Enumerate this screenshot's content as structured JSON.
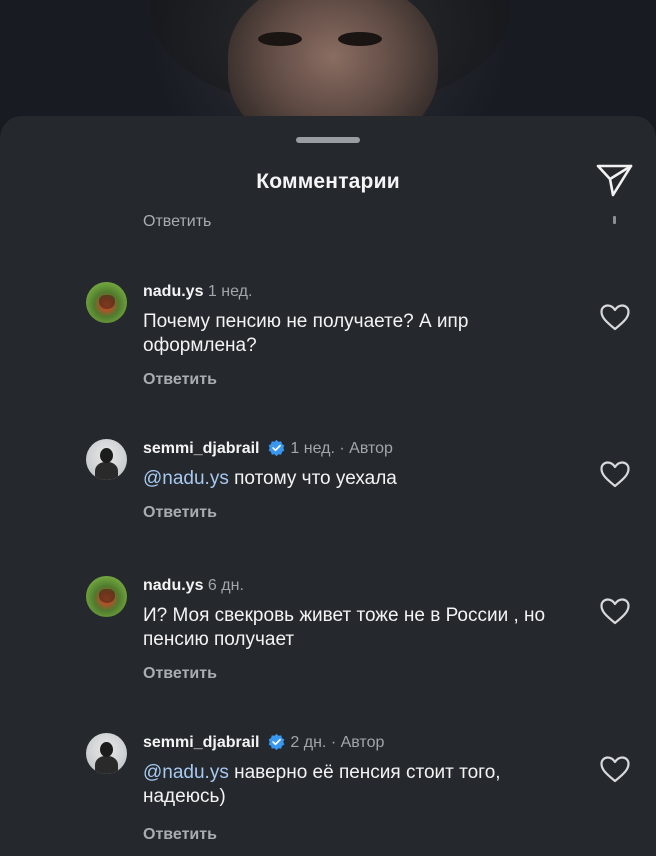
{
  "header": {
    "title": "Комментарии"
  },
  "cut_reply_label": "Ответить",
  "comments": [
    {
      "username": "nadu.ys",
      "time": "1 нед.",
      "verified": false,
      "author_badge": "",
      "mention": "",
      "text": "Почему пенсию не получаете? А ипр оформлена?",
      "reply_label": "Ответить",
      "avatar": "butterfly-avatar"
    },
    {
      "username": "semmi_djabrail",
      "time": "1 нед.",
      "verified": true,
      "author_badge": "· Автор",
      "mention": "@nadu.ys",
      "text": "потому что уехала",
      "reply_label": "Ответить",
      "avatar": "person-avatar"
    },
    {
      "username": "nadu.ys",
      "time": "6 дн.",
      "verified": false,
      "author_badge": "",
      "mention": "",
      "text": "И? Моя свекровь живет тоже не в России , но пенсию получает",
      "reply_label": "Ответить",
      "avatar": "butterfly-avatar"
    },
    {
      "username": "semmi_djabrail",
      "time": "2 дн.",
      "verified": true,
      "author_badge": "· Автор",
      "mention": "@nadu.ys",
      "text": "наверно её пенсия стоит того, надеюсь)",
      "reply_label": "Ответить",
      "avatar": "person-avatar"
    }
  ],
  "colors": {
    "sheet_background": "#25292e",
    "mention": "#a7c9f0",
    "verified_badge": "#3897f0",
    "secondary_text": "#a2a5a9"
  }
}
